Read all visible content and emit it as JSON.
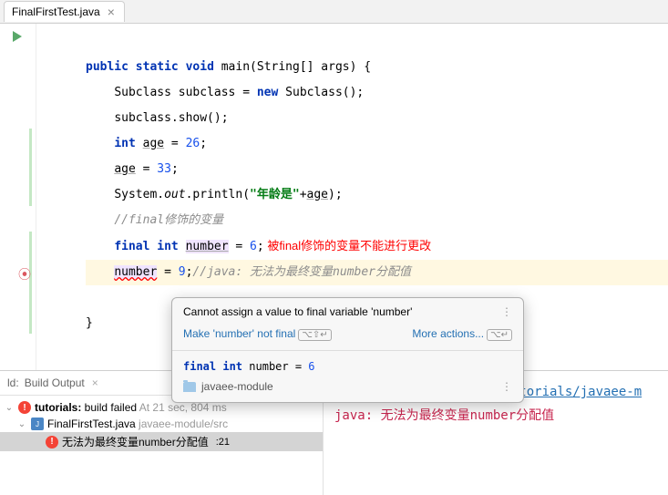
{
  "tab": {
    "filename": "FinalFirstTest.java"
  },
  "code": {
    "l1_public": "public",
    "l1_static": "static",
    "l1_void": "void",
    "l1_main": " main(String[] args) {",
    "l2a": "Subclass subclass = ",
    "l2_new": "new",
    "l2b": " Subclass();",
    "l3": "subclass.show();",
    "l4_int": "int",
    "l4_age": "age",
    "l4_eq": " = ",
    "l4_val": "26",
    "l4_semi": ";",
    "l5_age": "age",
    "l5_eq": " = ",
    "l5_val": "33",
    "l5_semi": ";",
    "l6a": "System.",
    "l6_out": "out",
    "l6b": ".println(",
    "l6_str": "\"年龄是\"",
    "l6c": "+",
    "l6_age": "age",
    "l6d": ");",
    "l7_cm": "//final修饰的变量",
    "l8_final": "final",
    "l8_int": "int",
    "l8_num": "number",
    "l8_eq": " = ",
    "l8_val": "6",
    "l8_semi": ";",
    "l8_note": " 被final修饰的变量不能进行更改",
    "l9_num": "number",
    "l9_eq": " = ",
    "l9_val": "9",
    "l9_semi": ";",
    "l9_cm": "//java: 无法为最终变量number分配值",
    "close1": "}",
    "close2": "}"
  },
  "popup": {
    "title": "Cannot assign a value to final variable 'number'",
    "fix": "Make 'number' not final",
    "more": "More actions...",
    "code_kw1": "final",
    "code_kw2": "int",
    "code_var": " number = ",
    "code_val": "6",
    "module": "javaee-module"
  },
  "build": {
    "header_l": "ld:",
    "header_title": "Build Output",
    "t1a": "tutorials:",
    "t1b": " build failed",
    "t1_time": "At 21 sec, 804 ms",
    "t2a": "FinalFirstTest.java ",
    "t2_path": "javaee-module/src",
    "t3_msg": "无法为最终变量number分配值",
    "t3_line": ":21",
    "link": "/Volumes/feng/project/tutorials/javaee-m",
    "err_label": "java:",
    "err_msg": "无法为最终变量number分配值"
  }
}
